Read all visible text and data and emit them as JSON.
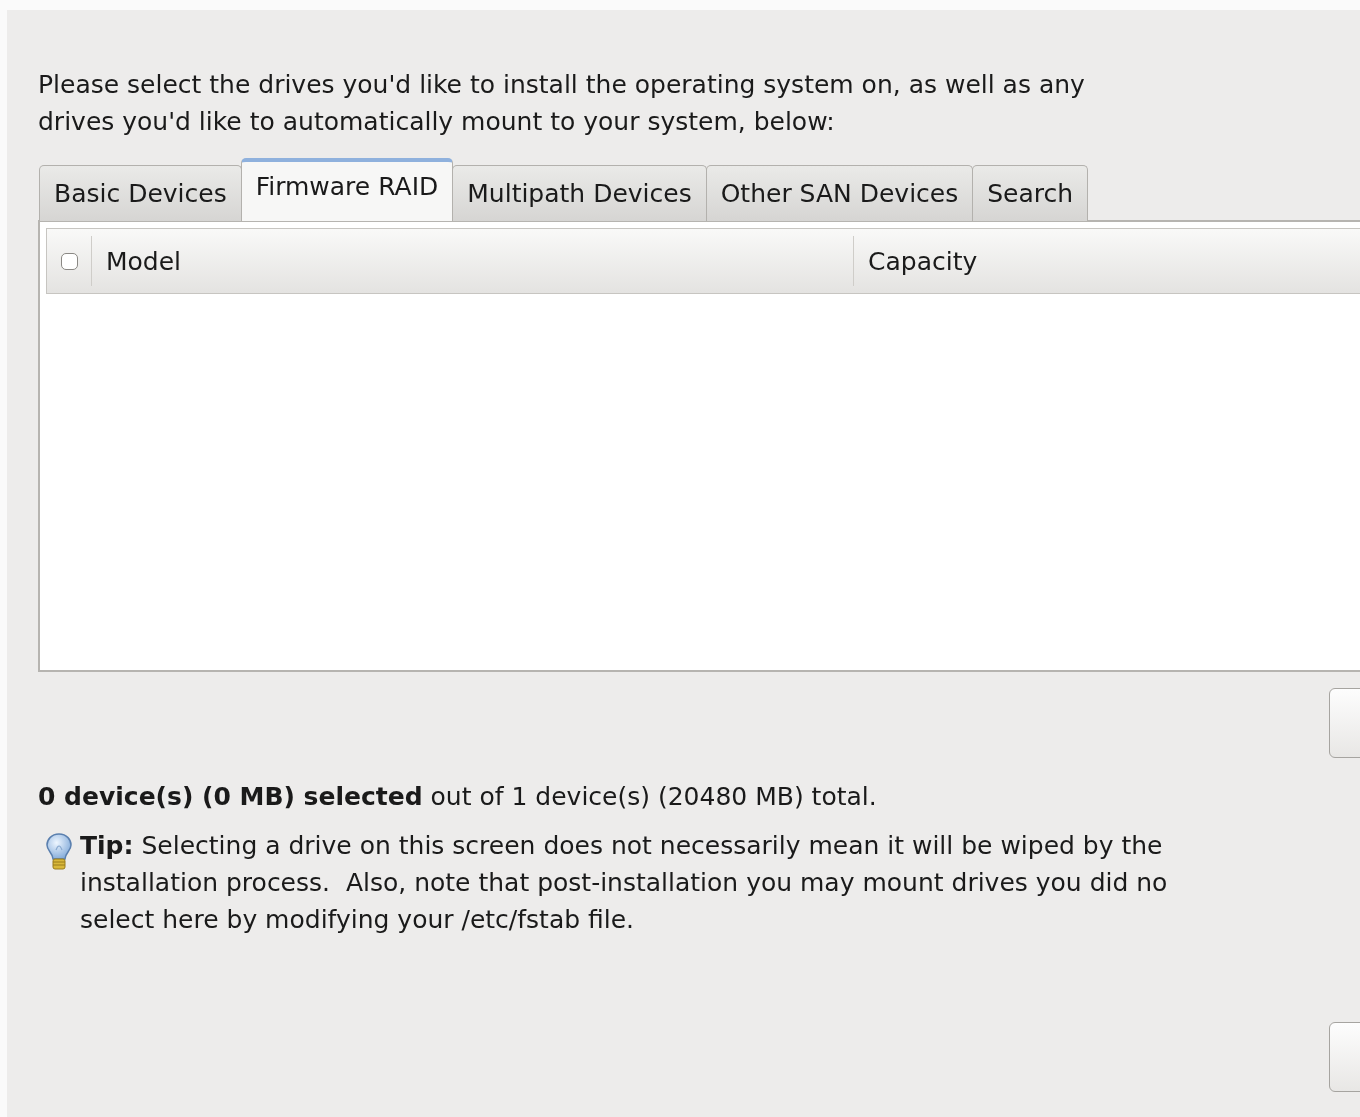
{
  "intro": [
    "Please select the drives you'd like to install the operating system on, as well as any",
    "drives you'd like to automatically mount to your system, below:"
  ],
  "tabs": [
    {
      "label": "Basic Devices",
      "selected": false
    },
    {
      "label": "Firmware RAID",
      "selected": true
    },
    {
      "label": "Multipath Devices",
      "selected": false
    },
    {
      "label": "Other SAN Devices",
      "selected": false
    },
    {
      "label": "Search",
      "selected": false
    }
  ],
  "table": {
    "select_all": {
      "checked": false
    },
    "columns": [
      "Model",
      "Capacity"
    ]
  },
  "summary": "**0 device(s) (0 MB) selected** out of 1 device(s) (20480 MB) total.",
  "tip": [
    "**Tip:** Selecting a drive on this screen does not necessarily mean it will be wiped by the",
    "installation process.  Also, note that post-installation you may mount drives you did no",
    "select here by modifying your /etc/fstab file."
  ]
}
